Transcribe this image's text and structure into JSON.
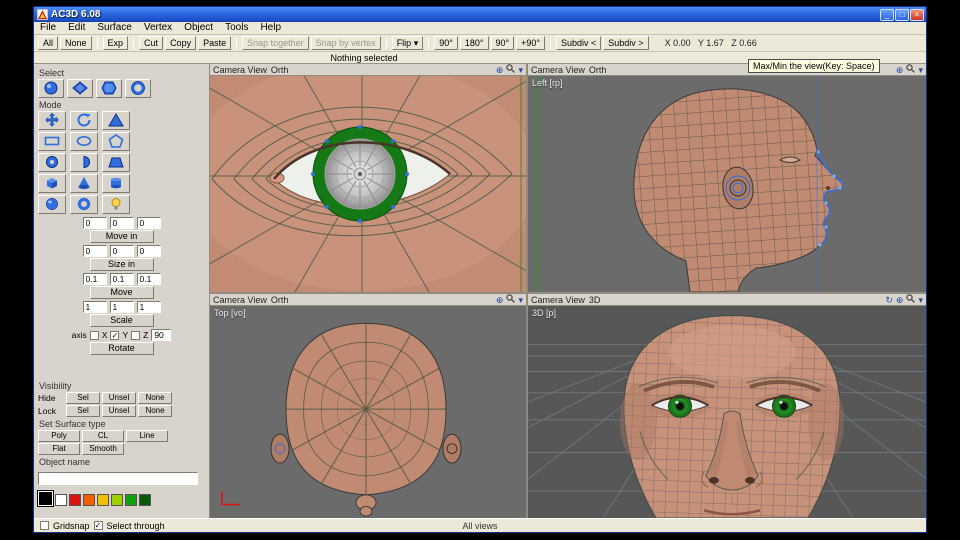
{
  "window": {
    "title": "AC3D 6.08",
    "minimize": "_",
    "maximize": "□",
    "close": "×"
  },
  "menu": {
    "items": [
      "File",
      "Edit",
      "Surface",
      "Vertex",
      "Object",
      "Tools",
      "Help"
    ]
  },
  "toolbar": {
    "all": "All",
    "none": "None",
    "exp": "Exp",
    "cut": "Cut",
    "copy": "Copy",
    "paste": "Paste",
    "snap_together": "Snap together",
    "snap_by_vertex": "Snap by vertex",
    "flip": "Flip",
    "flip_arrow": "▾",
    "rot_90cw": "90°",
    "rot_180": "180°",
    "rot_90ccw": "90°",
    "rot_plus90": "+90°",
    "subdiv_down": "Subdiv <",
    "subdiv_up": "Subdiv >",
    "coords": "X 0.00   Y 1.67   Z 0.66"
  },
  "statusline": {
    "text": "Nothing selected"
  },
  "panel": {
    "select_label": "Select",
    "mode_label": "Mode",
    "transform": {
      "groups": [
        {
          "fields": [
            "0",
            "0",
            "0"
          ],
          "button": "Move in"
        },
        {
          "fields": [
            "0",
            "0",
            "0"
          ],
          "button": "Size in"
        },
        {
          "fields": [
            "0.1",
            "0.1",
            "0.1"
          ],
          "button": "Move"
        },
        {
          "fields": [
            "1",
            "1",
            "1"
          ],
          "button": "Scale"
        }
      ],
      "axis_label": "axis",
      "axes": [
        "X",
        "Y",
        "Z"
      ],
      "axis_checks": [
        "",
        "✓",
        ""
      ],
      "angle": "90",
      "rotate_button": "Rotate"
    },
    "visibility": {
      "label": "Visibility",
      "rows": [
        {
          "label": "Hide",
          "buttons": [
            "Sel",
            "Unsel",
            "None"
          ]
        },
        {
          "label": "Lock",
          "buttons": [
            "Sel",
            "Unsel",
            "None"
          ]
        }
      ]
    },
    "surface": {
      "label": "Set Surface type",
      "rows": [
        [
          "Poly",
          "CL",
          "Line"
        ],
        [
          "Flat",
          "Smooth"
        ]
      ]
    },
    "object_name": {
      "label": "Object name",
      "value": ""
    },
    "palette": {
      "swatches": [
        "#000000",
        "#ffffff",
        "#e01010",
        "#f06000",
        "#f0c000",
        "#a0d000",
        "#10a010",
        "#0a5a0a"
      ]
    }
  },
  "viewports": [
    {
      "title": "Camera View",
      "mode": "Orth",
      "label": ""
    },
    {
      "title": "Camera View",
      "mode": "Orth",
      "label": "Left [rp]"
    },
    {
      "title": "Camera View",
      "mode": "Orth",
      "label": "Top [vo]"
    },
    {
      "title": "Camera View",
      "mode": "3D",
      "label": "3D [p]"
    }
  ],
  "viewport_icons": {
    "pan": "⊕",
    "orbit": "↻",
    "menu": "▾"
  },
  "tooltip": {
    "text": "Max/Min the view(Key: Space)"
  },
  "statusbar": {
    "gridsnap_check": "",
    "gridsnap": "Gridsnap",
    "select_through_check": "✓",
    "select_through": "Select through",
    "center": "All views"
  }
}
